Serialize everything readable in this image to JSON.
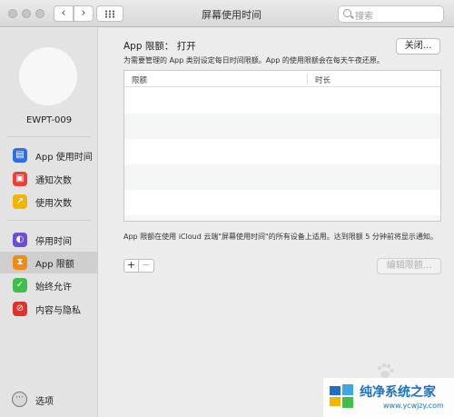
{
  "window": {
    "title": "屏幕使用时间",
    "search_placeholder": "搜索",
    "back_glyph": "‹",
    "forward_glyph": "›"
  },
  "sidebar": {
    "username": "EWPT-009",
    "items": [
      {
        "label": "App 使用时间",
        "icon": "hourglass-stack-icon",
        "color": "#2f6fe0",
        "glyph": "▤"
      },
      {
        "label": "通知次数",
        "icon": "notification-badge-icon",
        "color": "#e8403a",
        "glyph": "▣"
      },
      {
        "label": "使用次数",
        "icon": "pickup-arrow-icon",
        "color": "#f2b500",
        "glyph": "↗"
      },
      {
        "label": "停用时间",
        "icon": "moon-clock-icon",
        "color": "#6e4fd1",
        "glyph": "◐"
      },
      {
        "label": "App 限额",
        "icon": "hourglass-icon",
        "color": "#f08a1c",
        "glyph": "⧗",
        "selected": true
      },
      {
        "label": "始终允许",
        "icon": "checkmark-shield-icon",
        "color": "#3fbf4a",
        "glyph": "✓"
      },
      {
        "label": "内容与隐私",
        "icon": "restriction-icon",
        "color": "#e0322d",
        "glyph": "⊘"
      }
    ],
    "options_label": "选项",
    "options_glyph": "···"
  },
  "main": {
    "status_text": "App 限额： 打开",
    "close_button": "关闭...",
    "description": "为需要管理的 App 类别设定每日时间限额。App 的使用限额会在每天午夜还原。",
    "table": {
      "columns": [
        "限额",
        "时长"
      ],
      "rows": []
    },
    "note": "App 限额在使用 iCloud 云端\"屏幕使用时间\"的所有设备上适用。达到限额 5 分钟前将显示通知。",
    "add_glyph": "+",
    "remove_glyph": "−",
    "edit_button": "编辑限额..."
  },
  "watermark": {
    "title": "纯净系统之家",
    "url": "www.ycwjzy.com"
  },
  "colors": {
    "accent": "#1d6fc2",
    "sidebar_bg": "#e3e3e3",
    "selected_bg": "#cfcfcf"
  }
}
